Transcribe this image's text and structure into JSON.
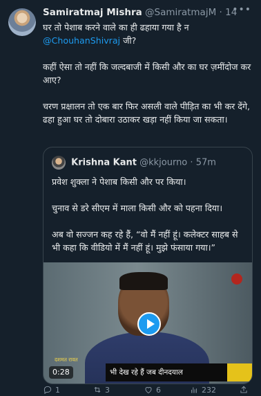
{
  "tweet": {
    "author_name": "Samiratmaj Mishra",
    "author_handle": "@SamiratmajM",
    "separator": "·",
    "time": "14m",
    "more_icon": "more-horizontal-icon",
    "paragraph1_part1": "घर तो पेशाब करने वाले का ही ढहाया गया है न",
    "mention": "@ChouhanShivraj",
    "paragraph1_part2": " जी?",
    "paragraph2": "कहीं ऐसा तो नहीं कि  जल्दबाजी में किसी और का घर ज़मींदोज कर आए?",
    "paragraph3": "चरण प्रक्षालन तो एक बार फिर असली वाले पीड़ित का भी कर देंगे, ढहा हुआ घर तो दोबारा उठाकर खड़ा नहीं किया जा सकता।"
  },
  "quote": {
    "author_name": "Krishna Kant",
    "author_handle": "@kkjourno",
    "separator": "·",
    "time": "57m",
    "paragraph1": "प्रवेश शुक्ला ने पेशाब किसी और पर किया।",
    "paragraph2": "चुनाव से डरे सीएम में माला किसी और को पहना दिया।",
    "paragraph3": "अब वो सज्जन कह रहे हैं, “वो मैं नहीं हूं। कलेक्टर साहब से भी कहा कि वीडियो में मैं नहीं हूं। मुझे फंसाया गया।”",
    "video": {
      "duration": "0:28",
      "caption": "भी देख रहे हैं जब दीनदयाल",
      "name_tag": "दशमत रावत"
    }
  },
  "actions": {
    "reply_count": "1",
    "retweet_count": "3",
    "like_count": "6",
    "views_count": "232"
  },
  "colors": {
    "background": "#15202b",
    "text": "#e7e9ea",
    "secondary": "#8b98a5",
    "accent": "#1d9bf0",
    "border": "#38444d"
  }
}
